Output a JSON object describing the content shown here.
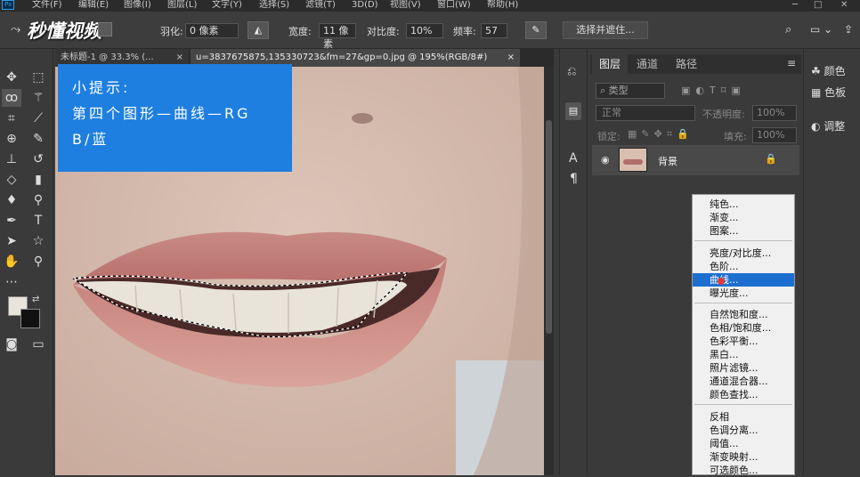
{
  "menubar": {
    "items": [
      "文件(F)",
      "编辑(E)",
      "图像(I)",
      "图层(L)",
      "文字(Y)",
      "选择(S)",
      "滤镜(T)",
      "3D(D)",
      "视图(V)",
      "窗口(W)",
      "帮助(H)"
    ],
    "app_badge": "Ps",
    "watermark": "秒懂视频"
  },
  "options": {
    "feather_label": "羽化:",
    "feather_value": "0 像素",
    "width_label": "宽度:",
    "width_value": "11 像素",
    "contrast_label": "对比度:",
    "contrast_value": "10%",
    "freq_label": "频率:",
    "freq_value": "57",
    "select_mask": "选择并遮住..."
  },
  "tabs": [
    {
      "label": "未标题-1 @ 33.3% (...",
      "close": "×"
    },
    {
      "label": "u=3837675875,135330723&fm=27&gp=0.jpg @ 195%(RGB/8#)",
      "close": "×"
    }
  ],
  "tip": {
    "line1": "小提示:",
    "line2": "第四个图形—曲线—RG",
    "line3": "B/蓝"
  },
  "layers_panel": {
    "tabs": [
      "图层",
      "通道",
      "路径"
    ],
    "filter_kind": "类型",
    "blend_mode": "正常",
    "opacity_label": "不透明度:",
    "opacity_value": "100%",
    "lock_label": "锁定:",
    "fill_label": "填充:",
    "fill_value": "100%",
    "layer_name": "背景"
  },
  "right_dock": {
    "color": "颜色",
    "swatches": "色板",
    "adjust": "调整"
  },
  "context_menu": {
    "group1": [
      "纯色...",
      "渐变...",
      "图案..."
    ],
    "group2": [
      "亮度/对比度...",
      "色阶...",
      "曲线...",
      "曝光度..."
    ],
    "group3": [
      "自然饱和度...",
      "色相/饱和度...",
      "色彩平衡...",
      "黑白...",
      "照片滤镜...",
      "通道混合器...",
      "颜色查找..."
    ],
    "group4": [
      "反相",
      "色调分离...",
      "阈值...",
      "渐变映射...",
      "可选颜色..."
    ],
    "selected": "曲线..."
  },
  "colors": {
    "accent": "#1e7fe0",
    "menu_highlight": "#1c6fd1",
    "ui_bg": "#3a3a3a"
  }
}
